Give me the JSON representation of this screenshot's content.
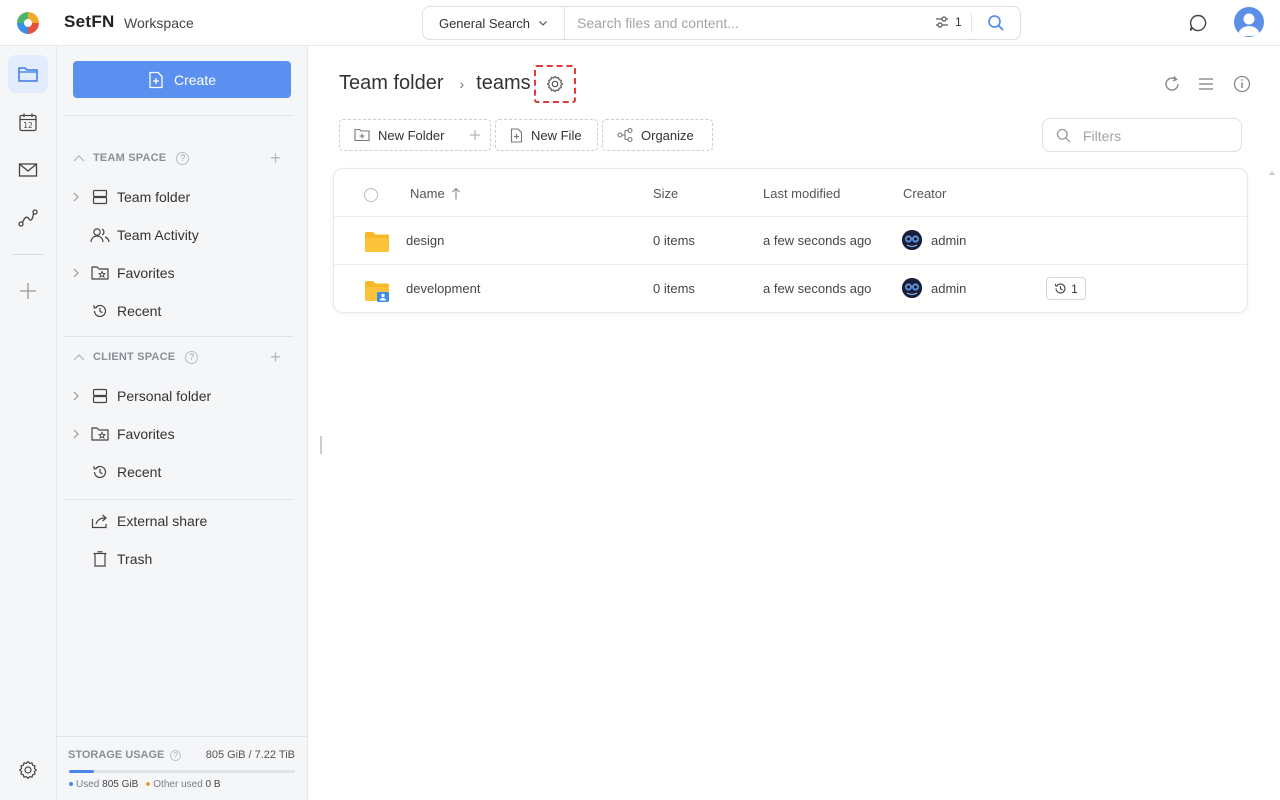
{
  "app": {
    "brand": "SetFN",
    "workspace": "Workspace"
  },
  "search": {
    "scope": "General Search",
    "placeholder": "Search files and content...",
    "filter_count": "1"
  },
  "sidebar": {
    "create_label": "Create",
    "team_space": {
      "title": "TEAM SPACE",
      "items": [
        {
          "label": "Team folder",
          "icon": "server-icon"
        },
        {
          "label": "Team Activity",
          "icon": "users-icon"
        },
        {
          "label": "Favorites",
          "icon": "star-folder-icon"
        },
        {
          "label": "Recent",
          "icon": "history-icon"
        }
      ]
    },
    "client_space": {
      "title": "CLIENT SPACE",
      "items": [
        {
          "label": "Personal folder",
          "icon": "server-icon"
        },
        {
          "label": "Favorites",
          "icon": "star-folder-icon"
        },
        {
          "label": "Recent",
          "icon": "history-icon"
        }
      ]
    },
    "other_items": [
      {
        "label": "External share",
        "icon": "share-icon"
      },
      {
        "label": "Trash",
        "icon": "trash-icon"
      }
    ],
    "storage": {
      "title": "STORAGE USAGE",
      "value": "805 GiB / 7.22 TiB",
      "used_fraction": 0.11,
      "used_label": "Used",
      "used_value": "805 GiB",
      "other_label": "Other used",
      "other_value": "0 B"
    }
  },
  "breadcrumb": {
    "parent": "Team folder",
    "current": "teams"
  },
  "toolbar": {
    "new_folder": "New Folder",
    "new_file": "New File",
    "organize": "Organize",
    "filter_placeholder": "Filters"
  },
  "table": {
    "columns": {
      "name": "Name",
      "size": "Size",
      "modified": "Last modified",
      "creator": "Creator"
    },
    "rows": [
      {
        "name": "design",
        "size": "0 items",
        "modified": "a few seconds ago",
        "creator": "admin",
        "shared": false
      },
      {
        "name": "development",
        "size": "0 items",
        "modified": "a few seconds ago",
        "creator": "admin",
        "shared": true,
        "versions": "1"
      }
    ]
  },
  "colors": {
    "accent": "#5b8ff0",
    "folder": "#f7b928",
    "highlight": "#e03a3a"
  }
}
